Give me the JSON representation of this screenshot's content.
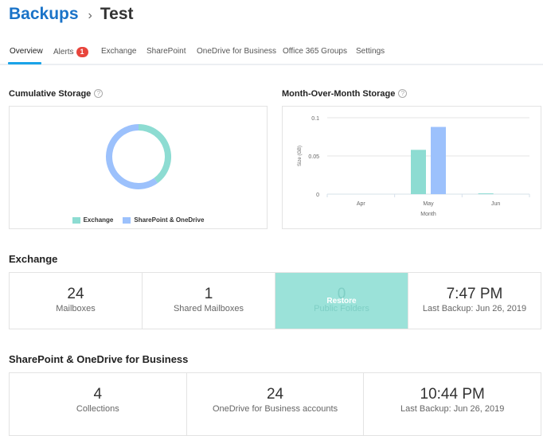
{
  "breadcrumb": {
    "root": "Backups",
    "separator": "›",
    "current": "Test"
  },
  "tabs": [
    {
      "label": "Overview",
      "active": true
    },
    {
      "label": "Alerts",
      "badge": "1"
    },
    {
      "label": "Exchange"
    },
    {
      "label": "SharePoint"
    },
    {
      "label": "OneDrive for Business"
    },
    {
      "label": "Office 365 Groups"
    },
    {
      "label": "Settings"
    }
  ],
  "cumulative": {
    "title": "Cumulative Storage",
    "help_icon": "?"
  },
  "monthly": {
    "title": "Month-Over-Month Storage",
    "help_icon": "?"
  },
  "colors": {
    "exchange": "#8ddcd2",
    "sharepoint": "#9cc1fc",
    "accent": "#1aa3e8",
    "brand": "#1a73c8",
    "badge": "#e8453c"
  },
  "chart_data": [
    {
      "type": "pie",
      "title": "Cumulative Storage",
      "donut": true,
      "labels": [
        "Exchange",
        "SharePoint & OneDrive"
      ],
      "values": [
        40,
        60
      ],
      "legend": "bottom"
    },
    {
      "type": "bar",
      "title": "Month-Over-Month Storage",
      "categories": [
        "Apr",
        "May",
        "Jun"
      ],
      "series": [
        {
          "name": "Exchange",
          "values": [
            0,
            0.058,
            0.001
          ]
        },
        {
          "name": "SharePoint & OneDrive",
          "values": [
            0,
            0.088,
            0
          ]
        }
      ],
      "xlabel": "Month",
      "ylabel": "Size (GB)",
      "ylim": [
        0,
        0.1
      ],
      "yticks": [
        "0",
        "0.05",
        "0.1"
      ],
      "grid": true
    }
  ],
  "exchange": {
    "title": "Exchange",
    "stats": [
      {
        "value": "24",
        "label": "Mailboxes"
      },
      {
        "value": "1",
        "label": "Shared Mailboxes"
      },
      {
        "value": "0",
        "label": "Public Folders",
        "overlay": "Restore"
      },
      {
        "value": "7:47 PM",
        "label": "Last Backup: Jun 26, 2019"
      }
    ]
  },
  "sharepoint": {
    "title": "SharePoint & OneDrive for Business",
    "stats": [
      {
        "value": "4",
        "label": "Collections"
      },
      {
        "value": "24",
        "label": "OneDrive for Business accounts"
      },
      {
        "value": "10:44 PM",
        "label": "Last Backup: Jun 26, 2019"
      }
    ]
  }
}
